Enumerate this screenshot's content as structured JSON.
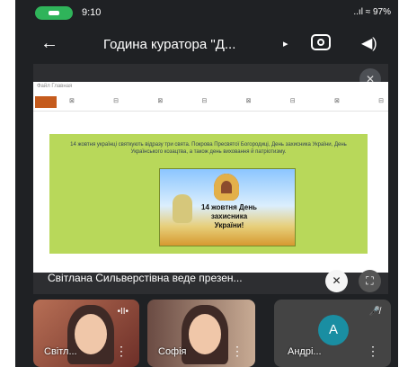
{
  "status": {
    "time": "9:10",
    "icons": "⊚ ⊡",
    "right": "..ıl ≈ 97%"
  },
  "header": {
    "back": "←",
    "title": "Година куратора \"Д...",
    "arrow": "▸",
    "camera": "camera-switch-icon",
    "audio": "◀)"
  },
  "slide": {
    "tab": "Файл   Главная",
    "tools": [
      "⊠",
      "⊟",
      "⊠",
      "⊟",
      "⊠",
      "⊟",
      "⊠",
      "⊟"
    ],
    "caption": "14 жовтня українці святкують відразу три свята. Покрова Пресвятої Богородиці, День захисника України, День Українського козацтва, а також день виховання й патріотизму.",
    "poster_title": "14 жовтня\nДень захисника\nУкраїни!"
  },
  "presenter": {
    "text": "Світлана Сильверстівна веде презен...",
    "mic_icon": "mic-off-icon",
    "expand_icon": "fullscreen-icon"
  },
  "participants": [
    {
      "name": "Світл...",
      "more": "⋮",
      "mic": "•II•"
    },
    {
      "name": "Софія",
      "more": "⋮",
      "mic": ""
    },
    {
      "name": "Андрі...",
      "more": "⋮",
      "mic": "🎤̸",
      "avatar": "A"
    }
  ]
}
